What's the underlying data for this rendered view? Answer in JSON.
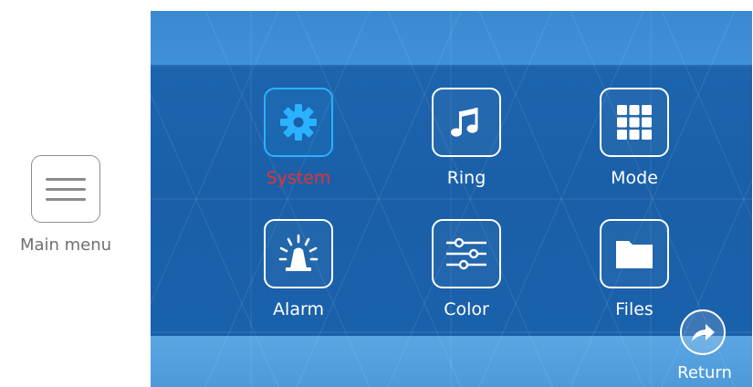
{
  "side_key": {
    "label": "Main menu",
    "icon": "hamburger-menu-icon"
  },
  "menu": {
    "items": [
      {
        "id": "system",
        "label": "System",
        "icon": "gear-icon",
        "selected": true
      },
      {
        "id": "ring",
        "label": "Ring",
        "icon": "music-note-icon",
        "selected": false
      },
      {
        "id": "mode",
        "label": "Mode",
        "icon": "grid-icon",
        "selected": false
      },
      {
        "id": "alarm",
        "label": "Alarm",
        "icon": "siren-icon",
        "selected": false
      },
      {
        "id": "color",
        "label": "Color",
        "icon": "sliders-icon",
        "selected": false
      },
      {
        "id": "files",
        "label": "Files",
        "icon": "folder-icon",
        "selected": false
      }
    ]
  },
  "return": {
    "label": "Return",
    "icon": "return-arrow-icon"
  },
  "colors": {
    "screen_bg": "#1a5fa8",
    "selected_border": "#2ab1ff",
    "selected_label": "#e8312f",
    "label": "#ffffff"
  }
}
